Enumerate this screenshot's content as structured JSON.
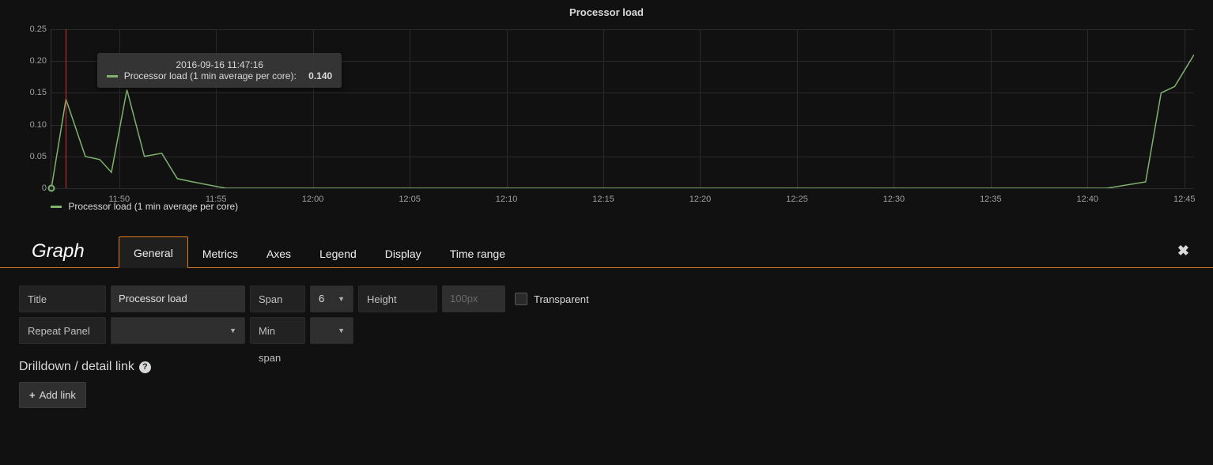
{
  "chart": {
    "title": "Processor load",
    "legend": "Processor load (1 min average per core)",
    "y_ticks": [
      "0",
      "0.05",
      "0.10",
      "0.15",
      "0.20",
      "0.25"
    ],
    "y_max": 0.25,
    "x_ticks": [
      "11:50",
      "11:55",
      "12:00",
      "12:05",
      "12:10",
      "12:15",
      "12:20",
      "12:25",
      "12:30",
      "12:35",
      "12:40",
      "12:45"
    ],
    "x_min_minutes": -3.5,
    "x_max_minutes": 55.5,
    "tooltip": {
      "time": "2016-09-16 11:47:16",
      "label": "Processor load (1 min average per core):",
      "value": "0.140",
      "at_x_minutes": -2.75
    },
    "marker_at_x_minutes": -2.75,
    "marker_dot_at": {
      "x_minutes": -3.5,
      "y": 0.0
    }
  },
  "chart_data": {
    "type": "line",
    "title": "Processor load",
    "ylabel": "",
    "xlabel": "",
    "ylim": [
      0,
      0.25
    ],
    "series": [
      {
        "name": "Processor load (1 min average per core)",
        "points": [
          {
            "x_minutes": -3.5,
            "y": 0.0
          },
          {
            "x_minutes": -2.75,
            "y": 0.14
          },
          {
            "x_minutes": -1.75,
            "y": 0.05
          },
          {
            "x_minutes": -1.0,
            "y": 0.045
          },
          {
            "x_minutes": -0.4,
            "y": 0.025
          },
          {
            "x_minutes": 0.4,
            "y": 0.155
          },
          {
            "x_minutes": 1.3,
            "y": 0.05
          },
          {
            "x_minutes": 2.2,
            "y": 0.055
          },
          {
            "x_minutes": 3.0,
            "y": 0.015
          },
          {
            "x_minutes": 3.8,
            "y": 0.01
          },
          {
            "x_minutes": 5.5,
            "y": 0.0
          },
          {
            "x_minutes": 51.0,
            "y": 0.0
          },
          {
            "x_minutes": 53.0,
            "y": 0.01
          },
          {
            "x_minutes": 53.8,
            "y": 0.15
          },
          {
            "x_minutes": 54.5,
            "y": 0.16
          },
          {
            "x_minutes": 55.5,
            "y": 0.21
          }
        ]
      }
    ]
  },
  "editor": {
    "title": "Graph",
    "tabs": [
      {
        "id": "general",
        "label": "General",
        "active": true
      },
      {
        "id": "metrics",
        "label": "Metrics",
        "active": false
      },
      {
        "id": "axes",
        "label": "Axes",
        "active": false
      },
      {
        "id": "legend",
        "label": "Legend",
        "active": false
      },
      {
        "id": "display",
        "label": "Display",
        "active": false
      },
      {
        "id": "timerange",
        "label": "Time range",
        "active": false
      }
    ],
    "close_label": "✖",
    "form": {
      "title_label": "Title",
      "title_value": "Processor load",
      "span_label": "Span",
      "span_value": "6",
      "height_label": "Height",
      "height_placeholder": "100px",
      "transparent_label": "Transparent",
      "repeat_label": "Repeat Panel",
      "minspan_label": "Min span"
    },
    "section_heading": "Drilldown / detail link",
    "add_link_label": "Add link"
  },
  "colors": {
    "accent": "#e27b1d",
    "series": "#7eb26d"
  }
}
